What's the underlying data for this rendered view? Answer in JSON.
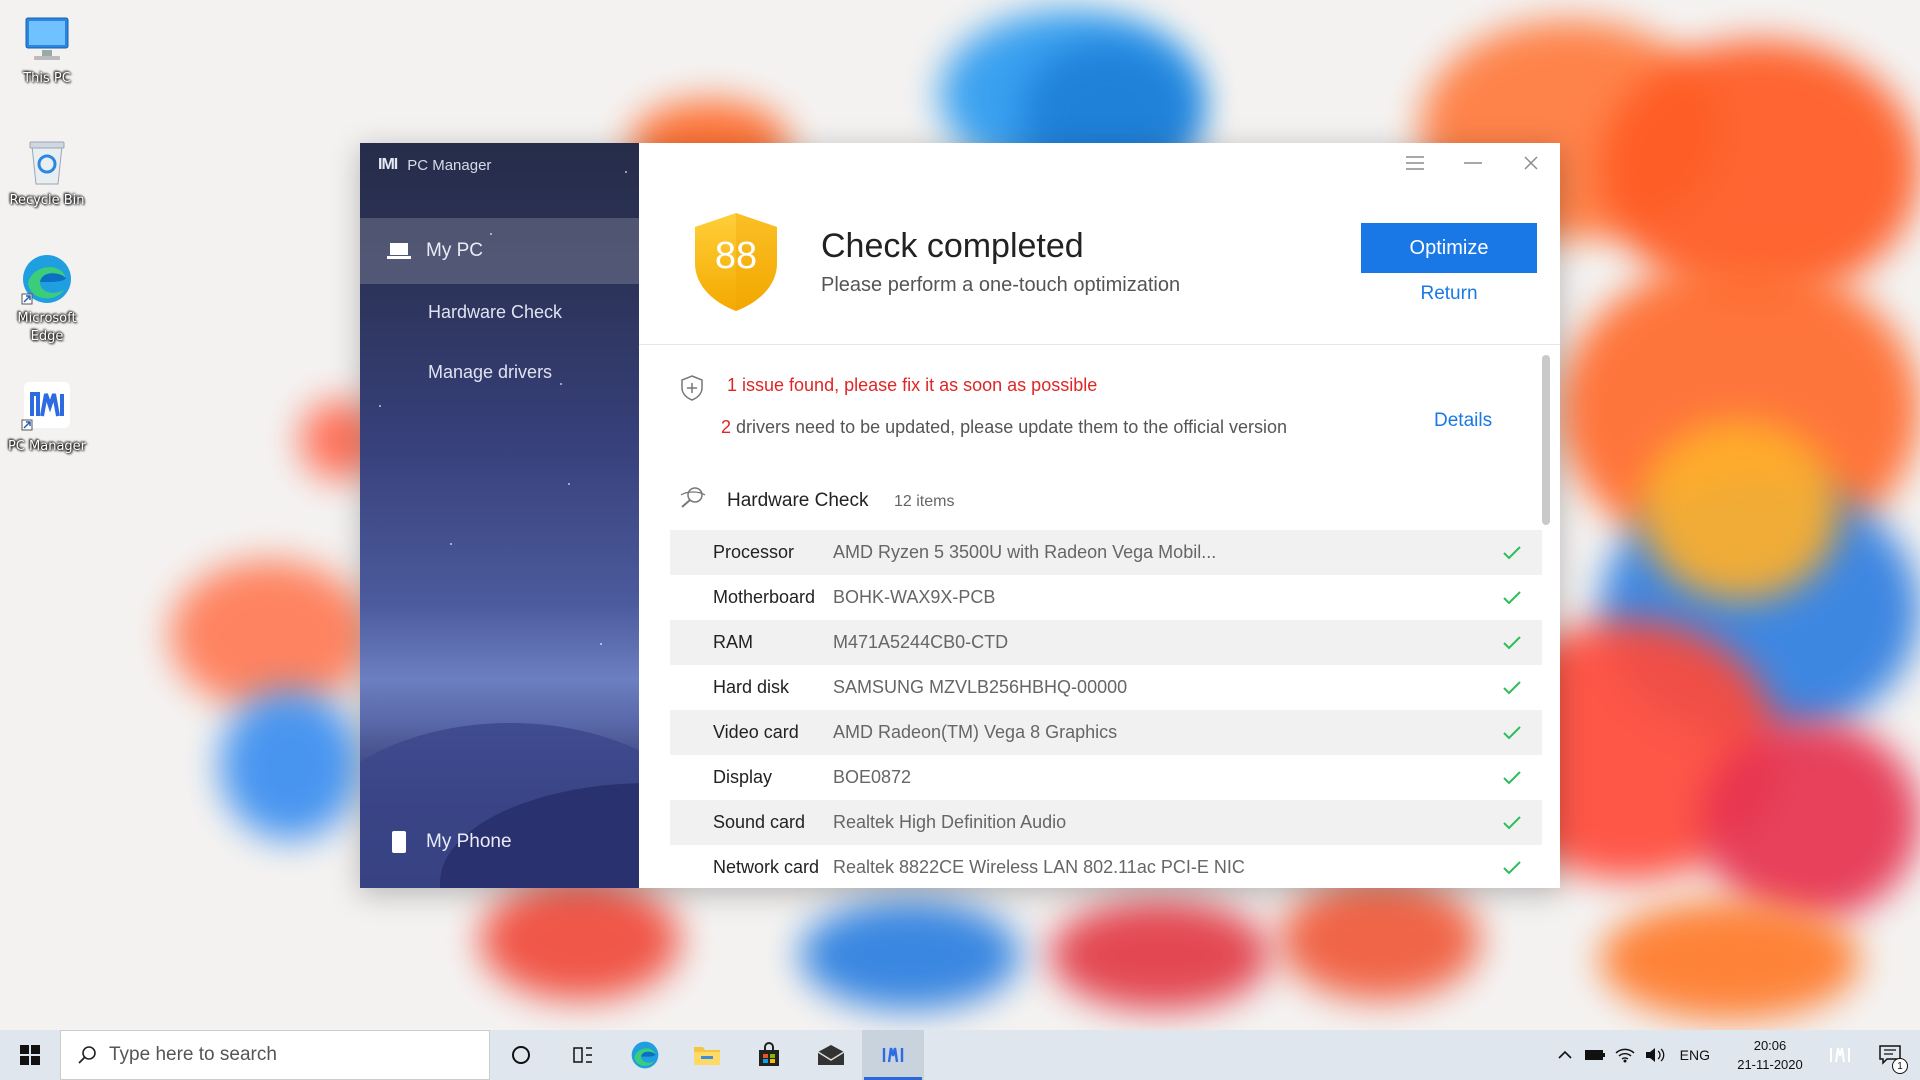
{
  "desktop": {
    "icons": [
      {
        "label": "This PC"
      },
      {
        "label": "Recycle Bin"
      },
      {
        "label": "Microsoft Edge"
      },
      {
        "label": "PC Manager"
      }
    ]
  },
  "app": {
    "title": "PC Manager",
    "sidebar": {
      "my_pc": "My PC",
      "hardware_check": "Hardware Check",
      "manage_drivers": "Manage drivers",
      "my_phone": "My Phone"
    },
    "header": {
      "score": "88",
      "title": "Check completed",
      "subtitle": "Please perform a one-touch optimization",
      "optimize": "Optimize",
      "return": "Return"
    },
    "issues": {
      "count": "1",
      "message": " issue found, please fix it as soon as possible",
      "drivers_count": "2",
      "drivers_message": " drivers need to be updated, please update them to the official version",
      "details": "Details"
    },
    "hardware": {
      "title": "Hardware Check",
      "count": "12 items",
      "rows": [
        {
          "label": "Processor",
          "value": "AMD Ryzen 5 3500U with Radeon Vega Mobil..."
        },
        {
          "label": "Motherboard",
          "value": "BOHK-WAX9X-PCB"
        },
        {
          "label": "RAM",
          "value": "M471A5244CB0-CTD"
        },
        {
          "label": "Hard disk",
          "value": "SAMSUNG MZVLB256HBHQ-00000"
        },
        {
          "label": "Video card",
          "value": "AMD Radeon(TM) Vega 8 Graphics"
        },
        {
          "label": "Display",
          "value": "BOE0872"
        },
        {
          "label": "Sound card",
          "value": "Realtek High Definition Audio"
        },
        {
          "label": "Network card",
          "value": "Realtek 8822CE Wireless LAN 802.11ac PCI-E NIC"
        }
      ]
    },
    "colors": {
      "accent": "#1a78e6",
      "error": "#e02525",
      "ok": "#2dbd5a",
      "shield": "#f7b500"
    }
  },
  "taskbar": {
    "search_placeholder": "Type here to search",
    "language": "ENG",
    "time": "20:06",
    "date": "21-11-2020",
    "notification_count": "1"
  }
}
